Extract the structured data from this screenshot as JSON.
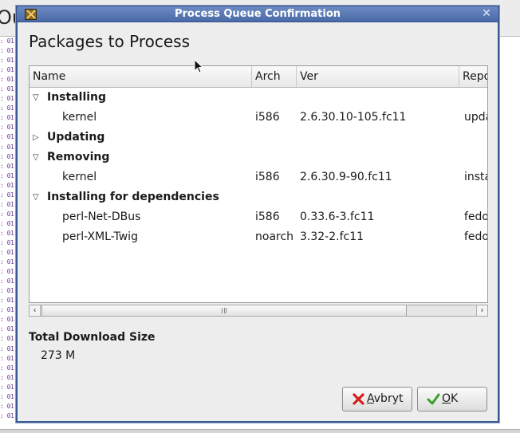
{
  "background": {
    "title_fragment": "Ou",
    "log_fragment": ": 01"
  },
  "dialog": {
    "title": "Process Queue Confirmation",
    "close_glyph": "✕",
    "heading": "Packages to Process",
    "columns": [
      "Name",
      "Arch",
      "Ver",
      "Repo"
    ],
    "groups": [
      {
        "label": "Installing",
        "expanded": true,
        "packages": [
          {
            "name": "kernel",
            "arch": "i586",
            "ver": "2.6.30.10-105.fc11",
            "repo": "upda"
          }
        ]
      },
      {
        "label": "Updating",
        "expanded": false,
        "packages": []
      },
      {
        "label": "Removing",
        "expanded": true,
        "packages": [
          {
            "name": "kernel",
            "arch": "i586",
            "ver": "2.6.30.9-90.fc11",
            "repo": "insta"
          }
        ]
      },
      {
        "label": "Installing for dependencies",
        "expanded": true,
        "packages": [
          {
            "name": "perl-Net-DBus",
            "arch": "i586",
            "ver": "0.33.6-3.fc11",
            "repo": "fedo"
          },
          {
            "name": "perl-XML-Twig",
            "arch": "noarch",
            "ver": "3.32-2.fc11",
            "repo": "fedo"
          }
        ]
      }
    ],
    "download_size_label": "Total Download Size",
    "download_size_value": "273 M",
    "buttons": {
      "cancel_mnemonic": "A",
      "cancel_rest": "vbryt",
      "ok_mnemonic": "O",
      "ok_rest": "K"
    },
    "colors": {
      "titlebar": "#5a7ab6",
      "cancel_icon": "#d42020",
      "ok_icon": "#3aa02a"
    }
  }
}
